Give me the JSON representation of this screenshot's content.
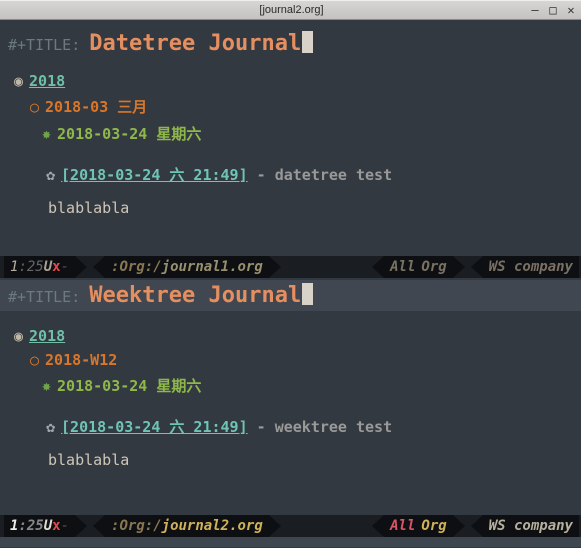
{
  "window": {
    "title": "[journal2.org]"
  },
  "pane1": {
    "title_keyword": "#+TITLE: ",
    "title_text": "Datetree Journal",
    "year": "2018",
    "month": "2018-03 三月",
    "day": "2018-03-24 星期六",
    "timestamp": "[2018-03-24 六 21:49]",
    "entry_suffix": " - datetree test",
    "body": "blablabla"
  },
  "modeline1": {
    "line": "1",
    "col": ":25",
    "u": " U",
    "x": "x",
    "dash": "-",
    "org_label": ":Org:",
    "slash": "/",
    "filename": "journal1.org",
    "all": "All",
    "mode": "Org",
    "ws_prefix": "WS ",
    "ws_name": "company"
  },
  "pane2": {
    "title_keyword": "#+TITLE: ",
    "title_text": "Weektree Journal",
    "year": "2018",
    "week": "2018-W12",
    "day": "2018-03-24 星期六",
    "timestamp": "[2018-03-24 六 21:49]",
    "entry_suffix": " - weektree test",
    "body": "blablabla"
  },
  "modeline2": {
    "line": "1",
    "col": ":25",
    "u": " U",
    "x": "x",
    "dash": "-",
    "org_label": ":Org:",
    "slash": "/",
    "filename": "journal2.org",
    "all": "All",
    "mode": "Org",
    "ws_prefix": "WS ",
    "ws_name": "company"
  }
}
